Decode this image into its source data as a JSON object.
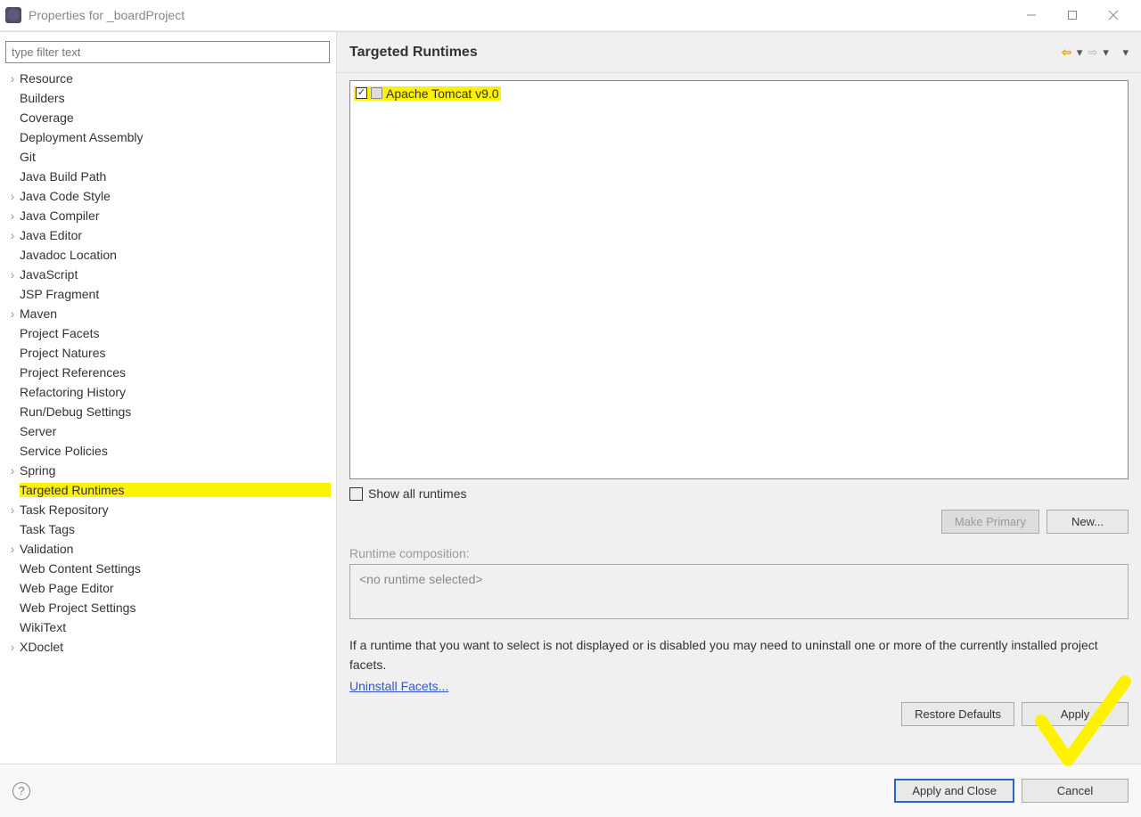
{
  "window": {
    "title": "Properties for _boardProject"
  },
  "left": {
    "filter_placeholder": "type filter text",
    "tree": [
      {
        "label": "Resource",
        "expandable": true
      },
      {
        "label": "Builders",
        "expandable": false
      },
      {
        "label": "Coverage",
        "expandable": false
      },
      {
        "label": "Deployment Assembly",
        "expandable": false
      },
      {
        "label": "Git",
        "expandable": false
      },
      {
        "label": "Java Build Path",
        "expandable": false
      },
      {
        "label": "Java Code Style",
        "expandable": true
      },
      {
        "label": "Java Compiler",
        "expandable": true
      },
      {
        "label": "Java Editor",
        "expandable": true
      },
      {
        "label": "Javadoc Location",
        "expandable": false
      },
      {
        "label": "JavaScript",
        "expandable": true
      },
      {
        "label": "JSP Fragment",
        "expandable": false
      },
      {
        "label": "Maven",
        "expandable": true
      },
      {
        "label": "Project Facets",
        "expandable": false
      },
      {
        "label": "Project Natures",
        "expandable": false
      },
      {
        "label": "Project References",
        "expandable": false
      },
      {
        "label": "Refactoring History",
        "expandable": false
      },
      {
        "label": "Run/Debug Settings",
        "expandable": false
      },
      {
        "label": "Server",
        "expandable": false
      },
      {
        "label": "Service Policies",
        "expandable": false
      },
      {
        "label": "Spring",
        "expandable": true
      },
      {
        "label": "Targeted Runtimes",
        "expandable": false,
        "selected": true,
        "highlight": true
      },
      {
        "label": "Task Repository",
        "expandable": true
      },
      {
        "label": "Task Tags",
        "expandable": false
      },
      {
        "label": "Validation",
        "expandable": true
      },
      {
        "label": "Web Content Settings",
        "expandable": false
      },
      {
        "label": "Web Page Editor",
        "expandable": false
      },
      {
        "label": "Web Project Settings",
        "expandable": false
      },
      {
        "label": "WikiText",
        "expandable": false
      },
      {
        "label": "XDoclet",
        "expandable": true
      }
    ]
  },
  "right": {
    "title": "Targeted Runtimes",
    "runtimes": [
      {
        "label": "Apache Tomcat v9.0",
        "checked": true
      }
    ],
    "show_all_label": "Show all runtimes",
    "buttons": {
      "make_primary": "Make Primary",
      "new": "New...",
      "restore_defaults": "Restore Defaults",
      "apply": "Apply"
    },
    "runtime_composition_label": "Runtime composition:",
    "runtime_composition_value": "<no runtime selected>",
    "hint": "If a runtime that you want to select is not displayed or is disabled you may need to uninstall one or more of the currently installed project facets.",
    "uninstall_link": "Uninstall Facets..."
  },
  "footer": {
    "apply_and_close": "Apply and Close",
    "cancel": "Cancel"
  }
}
